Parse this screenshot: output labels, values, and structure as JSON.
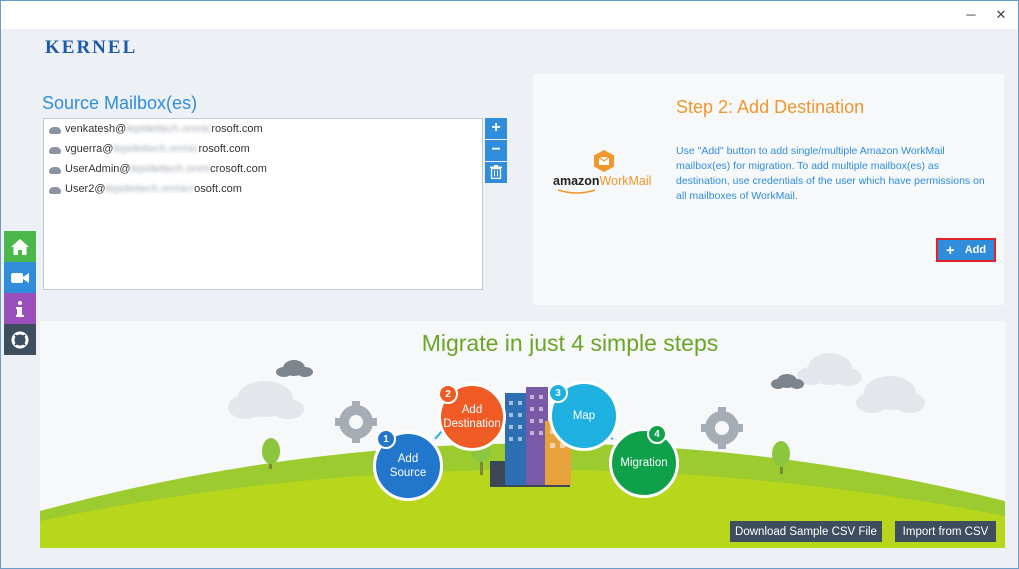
{
  "window": {
    "minimize_glyph": "─",
    "close_glyph": "✕"
  },
  "app": {
    "logo_text": "KERNEL"
  },
  "source": {
    "title": "Source Mailbox(es)",
    "mailboxes": [
      {
        "user": "venkatesh@",
        "hidden": "lepideitech.onmic",
        "domain": "rosoft.com"
      },
      {
        "user": "vguerra@",
        "hidden": "lepideitech.onmic",
        "domain": "rosoft.com"
      },
      {
        "user": "UserAdmin@",
        "hidden": "lepideitech.onmi",
        "domain": "crosoft.com"
      },
      {
        "user": "User2@",
        "hidden": "lepideitech.onmicr",
        "domain": "osoft.com"
      }
    ],
    "tools": {
      "add_glyph": "+",
      "remove_glyph": "−",
      "delete_icon": "trash-icon"
    }
  },
  "side_nav": [
    {
      "name": "home",
      "icon": "home-icon",
      "color": "#4cb84c"
    },
    {
      "name": "video",
      "icon": "video-camera-icon",
      "color": "#2f8ddb"
    },
    {
      "name": "info",
      "icon": "info-icon",
      "color": "#9b4fba"
    },
    {
      "name": "support",
      "icon": "lifebuoy-icon",
      "color": "#3f4e5f"
    }
  ],
  "destination": {
    "title": "Step 2: Add Destination",
    "logo_text_amazon": "amazon",
    "logo_text_workmail": "WorkMail",
    "description": "Use \"Add\" button to add single/multiple Amazon WorkMail mailbox(es) for migration. To add multiple mailbox(es) as destination, use credentials of the user which have permissions on all mailboxes of WorkMail.",
    "add_button": {
      "plus": "+",
      "label": "Add"
    }
  },
  "migrate": {
    "title": "Migrate in just 4 simple steps",
    "steps": [
      {
        "num": "1",
        "label": "Add Source",
        "color": "#2277cc"
      },
      {
        "num": "2",
        "label": "Add Destination",
        "color": "#ef5a25"
      },
      {
        "num": "3",
        "label": "Map",
        "color": "#1eb0e0"
      },
      {
        "num": "4",
        "label": "Migration",
        "color": "#0fa04a"
      }
    ],
    "download_csv": "Download Sample CSV File",
    "import_csv": "Import from CSV"
  },
  "colors": {
    "accent": "#2f8ddb",
    "orange": "#f0962a",
    "green_title": "#6aa626",
    "highlight": "#e0242a",
    "dark_button": "#3f4e5f"
  }
}
